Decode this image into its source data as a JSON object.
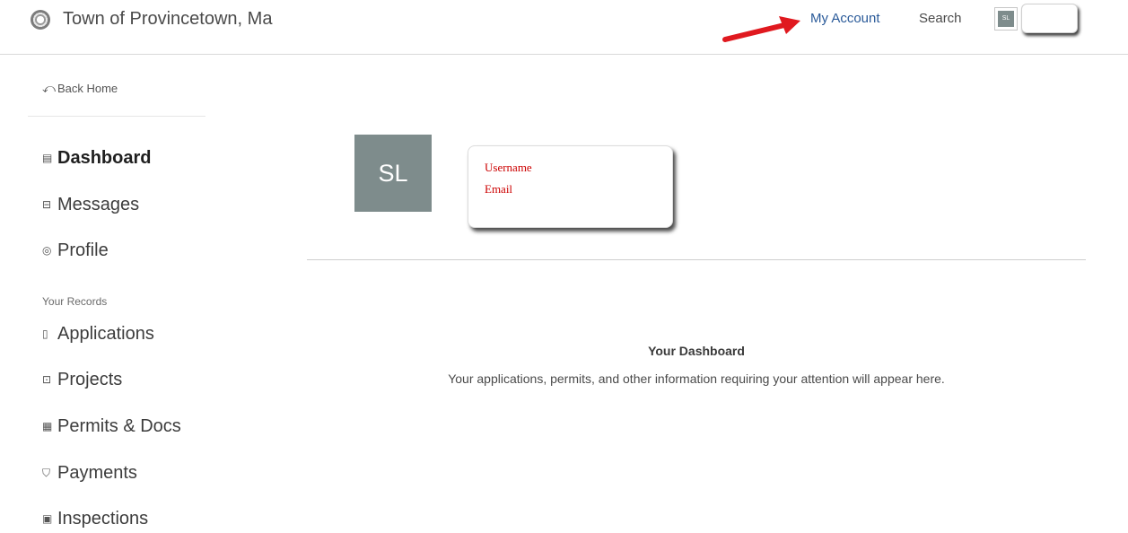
{
  "header": {
    "logo_icon": "town-seal-icon",
    "town_name": "Town of Provincetown, Ma",
    "my_account_label": "My Account",
    "search_label": "Search",
    "avatar_initials": "SL",
    "annotation_arrow_color": "#e0191f"
  },
  "sidebar": {
    "back_home": {
      "icon": "undo-arrow-icon",
      "label": "Back Home"
    },
    "items": [
      {
        "icon": "dashboard-icon",
        "label": "Dashboard",
        "active": true
      },
      {
        "icon": "inbox-icon",
        "label": "Messages"
      },
      {
        "icon": "user-circle-icon",
        "label": "Profile"
      }
    ],
    "records_heading": "Your Records",
    "records": [
      {
        "icon": "file-icon",
        "label": "Applications"
      },
      {
        "icon": "briefcase-icon",
        "label": "Projects"
      },
      {
        "icon": "certificate-icon",
        "label": "Permits & Docs"
      },
      {
        "icon": "cart-icon",
        "label": "Payments"
      },
      {
        "icon": "clipboard-icon",
        "label": "Inspections"
      }
    ]
  },
  "profile": {
    "avatar_initials": "SL",
    "avatar_color": "#7e8c8c",
    "username_label": "Username",
    "email_label": "Email",
    "annotation_text_color": "#cc0000"
  },
  "dashboard": {
    "title": "Your Dashboard",
    "description": "Your applications, permits, and other information requiring your attention will appear here."
  }
}
